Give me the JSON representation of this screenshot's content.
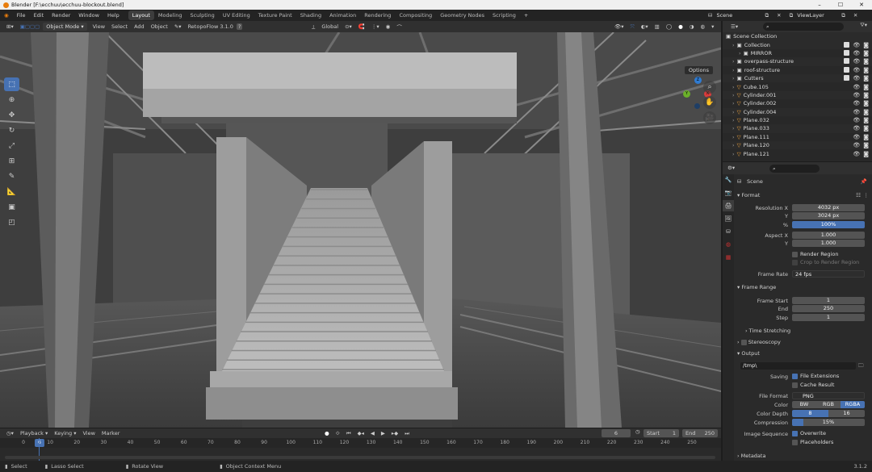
{
  "window": {
    "title": "Blender [F:\\ecchuu\\ecchuu-blockout.blend]",
    "min": "–",
    "max": "☐",
    "close": "✕"
  },
  "menu": [
    "File",
    "Edit",
    "Render",
    "Window",
    "Help"
  ],
  "workspaces": [
    "Layout",
    "Modeling",
    "Sculpting",
    "UV Editing",
    "Texture Paint",
    "Shading",
    "Animation",
    "Rendering",
    "Compositing",
    "Geometry Nodes",
    "Scripting"
  ],
  "scene_selector": {
    "scene": "Scene",
    "view_layer": "ViewLayer"
  },
  "viewport_header": {
    "mode": "Object Mode",
    "view": "View",
    "select": "Select",
    "add": "Add",
    "object": "Object",
    "addon": "RetopoFlow 3.1.0",
    "orientation": "Global"
  },
  "viewport": {
    "options": "Options",
    "axes": {
      "x": "X",
      "y": "Y",
      "z": "Z"
    }
  },
  "tools": [
    "select-box-icon",
    "cursor-icon",
    "move-icon",
    "rotate-icon",
    "scale-icon",
    "transform-icon",
    "annotate-icon",
    "measure-icon",
    "add-cube-icon",
    "extra-tool-icon"
  ],
  "outliner": {
    "root": "Scene Collection",
    "items": [
      {
        "name": "Collection",
        "indent": 1
      },
      {
        "name": "MIRROR",
        "indent": 2
      },
      {
        "name": "overpass-structure",
        "indent": 1
      },
      {
        "name": "roof-structure",
        "indent": 1
      },
      {
        "name": "Cutters",
        "indent": 1
      },
      {
        "name": "Cube.105",
        "indent": 1
      },
      {
        "name": "Cylinder.001",
        "indent": 1
      },
      {
        "name": "Cylinder.002",
        "indent": 1
      },
      {
        "name": "Cylinder.004",
        "indent": 1
      },
      {
        "name": "Plane.032",
        "indent": 1
      },
      {
        "name": "Plane.033",
        "indent": 1
      },
      {
        "name": "Plane.111",
        "indent": 1
      },
      {
        "name": "Plane.120",
        "indent": 1
      },
      {
        "name": "Plane.121",
        "indent": 1
      }
    ]
  },
  "properties": {
    "context": "Scene",
    "format": {
      "title": "Format",
      "res_x_label": "Resolution X",
      "res_x": "4032 px",
      "res_y_label": "Y",
      "res_y": "3024 px",
      "pct_label": "%",
      "pct": "100%",
      "aspect_x_label": "Aspect X",
      "aspect_x": "1.000",
      "aspect_y_label": "Y",
      "aspect_y": "1.000",
      "render_region": "Render Region",
      "crop": "Crop to Render Region",
      "frame_rate_label": "Frame Rate",
      "frame_rate": "24 fps"
    },
    "frame_range": {
      "title": "Frame Range",
      "start_label": "Frame Start",
      "start": "1",
      "end_label": "End",
      "end": "250",
      "step_label": "Step",
      "step": "1",
      "time_stretching": "Time Stretching",
      "stereoscopy": "Stereoscopy"
    },
    "output": {
      "title": "Output",
      "path": "/tmp\\",
      "saving_label": "Saving",
      "file_ext": "File Extensions",
      "cache": "Cache Result",
      "file_format_label": "File Format",
      "file_format": "PNG",
      "color_label": "Color",
      "color_bw": "BW",
      "color_rgb": "RGB",
      "color_rgba": "RGBA",
      "depth_label": "Color Depth",
      "depth_8": "8",
      "depth_16": "16",
      "compression_label": "Compression",
      "compression": "15%",
      "image_seq_label": "Image Sequence",
      "overwrite": "Overwrite",
      "placeholders": "Placeholders"
    },
    "metadata": "Metadata"
  },
  "timeline": {
    "playback": "Playback",
    "keying": "Keying",
    "view": "View",
    "marker": "Marker",
    "current_frame": "6",
    "start_label": "Start",
    "start": "1",
    "end_label": "End",
    "end": "250",
    "ticks": [
      "0",
      "10",
      "20",
      "30",
      "40",
      "50",
      "60",
      "70",
      "80",
      "90",
      "100",
      "110",
      "120",
      "130",
      "140",
      "150",
      "160",
      "170",
      "180",
      "190",
      "200",
      "210",
      "220",
      "230",
      "240",
      "250"
    ]
  },
  "status": {
    "select": "Select",
    "lasso": "Lasso Select",
    "rotate": "Rotate View",
    "context": "Object Context Menu",
    "version": "3.1.2"
  }
}
